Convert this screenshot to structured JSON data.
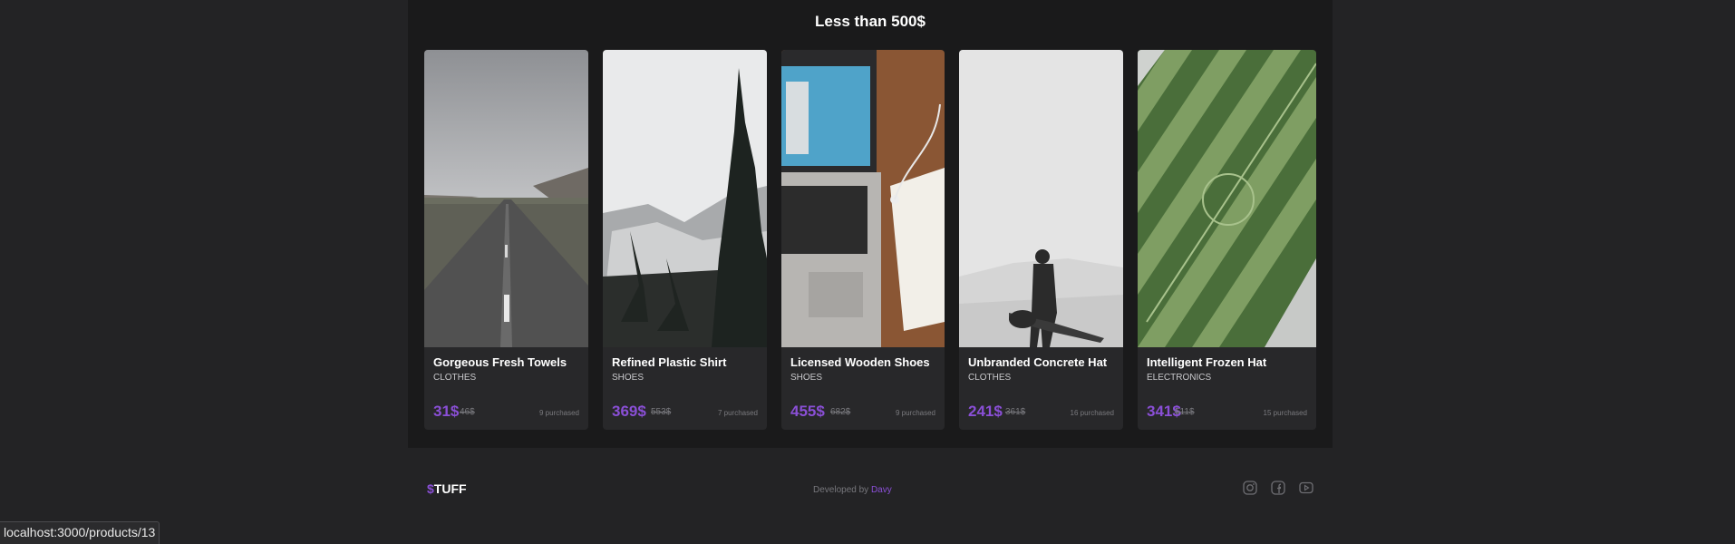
{
  "section": {
    "title": "Less than 500$"
  },
  "products": [
    {
      "name": "Gorgeous Fresh Towels",
      "category": "CLOTHES",
      "price": "31$",
      "old_price": "46$",
      "purchased": "9 purchased",
      "image": "road-photo"
    },
    {
      "name": "Refined Plastic Shirt",
      "category": "SHOES",
      "price": "369$",
      "old_price": "553$",
      "purchased": "7 purchased",
      "image": "pine-forest-photo"
    },
    {
      "name": "Licensed Wooden Shoes",
      "category": "SHOES",
      "price": "455$",
      "old_price": "682$",
      "purchased": "9 purchased",
      "image": "laptop-desk-photo"
    },
    {
      "name": "Unbranded Concrete Hat",
      "category": "CLOTHES",
      "price": "241$",
      "old_price": "361$",
      "purchased": "16 purchased",
      "image": "guitarist-desert-photo"
    },
    {
      "name": "Intelligent Frozen Hat",
      "category": "ELECTRONICS",
      "price": "341$",
      "old_price": "511$",
      "purchased": "15 purchased",
      "image": "soccer-field-aerial-photo"
    }
  ],
  "footer": {
    "logo_symbol": "$",
    "logo_text": "TUFF",
    "developed_by": "Developed by",
    "author": "Davy",
    "social": [
      "instagram-icon",
      "facebook-icon",
      "youtube-icon"
    ]
  },
  "status_bar": {
    "url": "localhost:3000/products/13"
  },
  "colors": {
    "accent": "#8a4fd6",
    "page_bg": "#232325",
    "section_bg": "#1a1a1b",
    "card_bg": "#28282a"
  }
}
